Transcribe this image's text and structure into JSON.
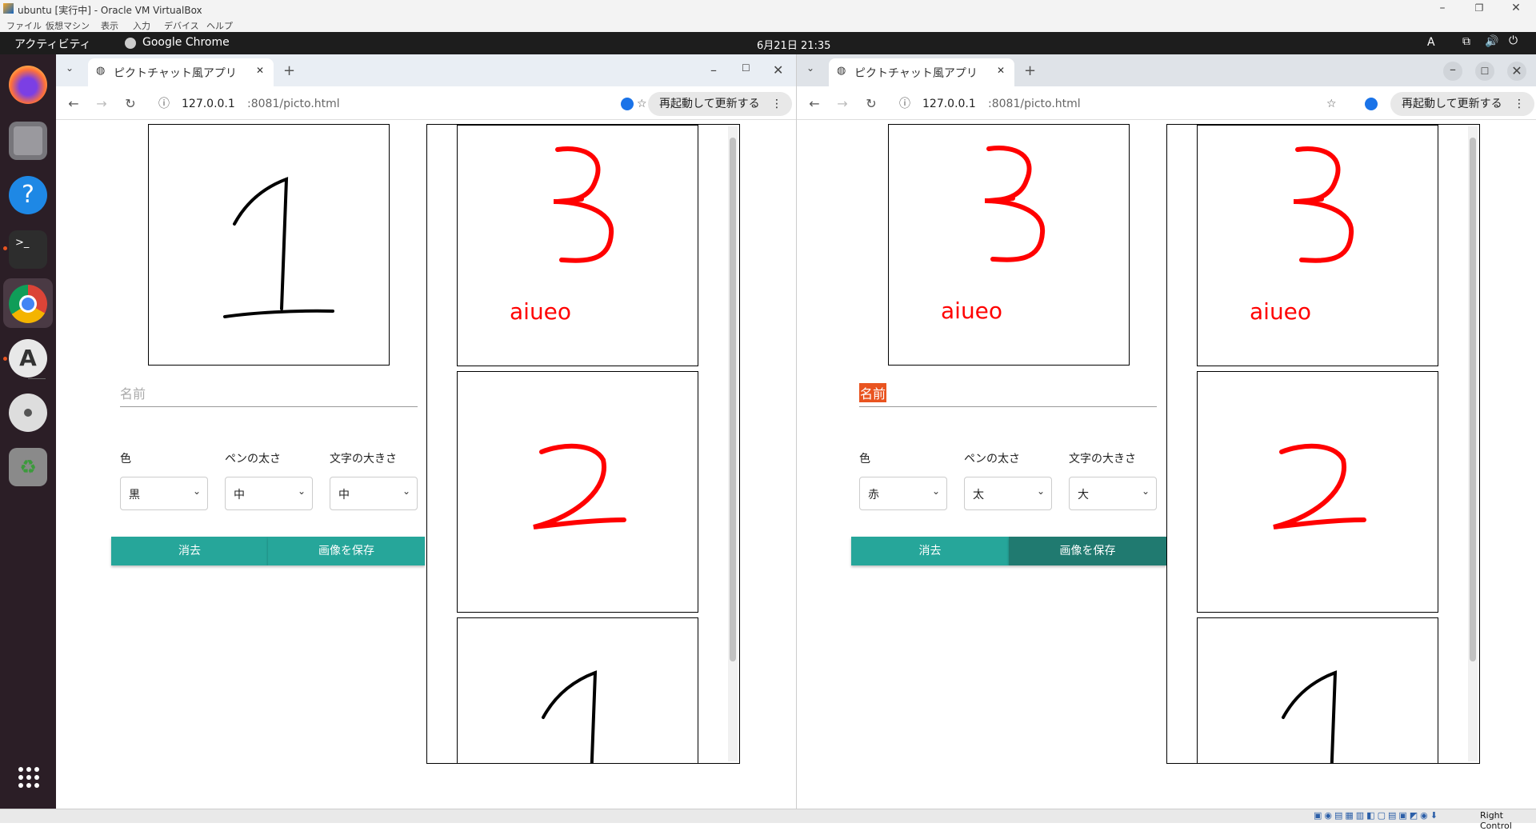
{
  "vbox": {
    "title": "ubuntu [実行中] - Oracle VM VirtualBox",
    "menu": [
      "ファイル",
      "仮想マシン",
      "表示",
      "入力",
      "デバイス",
      "ヘルプ"
    ],
    "host_key": "Right Control"
  },
  "topbar": {
    "activities": "アクティビティ",
    "app": "Google Chrome",
    "clock": "6月21日  21:35",
    "input": "A"
  },
  "dock": [
    "firefox-icon",
    "files-icon",
    "help-icon",
    "terminal-icon",
    "chrome-icon",
    "software-icon",
    "dvd-icon",
    "trash-icon",
    "app-grid-icon"
  ],
  "windows": [
    {
      "tab_title": "ピクトチャット風アプリ",
      "url_host": "127.0.0.1",
      "url_rest": ":8081/picto.html",
      "relaunch": "再起動して更新する",
      "name_value": "",
      "name_placeholder": "名前",
      "labels": {
        "color": "色",
        "pen": "ペンの太さ",
        "font": "文字の大きさ"
      },
      "selects": {
        "color": "黒",
        "pen": "中",
        "font": "中"
      },
      "buttons": {
        "clear": "消去",
        "save": "画像を保存"
      },
      "canvas_text": "",
      "feed": [
        {
          "figure": "3",
          "text": "aiueo",
          "color": "#ff0000"
        },
        {
          "figure": "2",
          "text": "",
          "color": "#ff0000"
        },
        {
          "figure": "1",
          "text": "",
          "color": "#000000"
        }
      ]
    },
    {
      "tab_title": "ピクトチャット風アプリ",
      "url_host": "127.0.0.1",
      "url_rest": ":8081/picto.html",
      "relaunch": "再起動して更新する",
      "name_value": "名前",
      "name_placeholder": "名前",
      "labels": {
        "color": "色",
        "pen": "ペンの太さ",
        "font": "文字の大きさ"
      },
      "selects": {
        "color": "赤",
        "pen": "太",
        "font": "大"
      },
      "buttons": {
        "clear": "消去",
        "save": "画像を保存"
      },
      "canvas_text": "aiueo",
      "feed": [
        {
          "figure": "3",
          "text": "aiueo",
          "color": "#ff0000"
        },
        {
          "figure": "2",
          "text": "",
          "color": "#ff0000"
        },
        {
          "figure": "1",
          "text": "",
          "color": "#000000"
        }
      ]
    }
  ],
  "colors": {
    "button": "#26a69a",
    "button_dark": "#207a70",
    "ink_red": "#ff0000",
    "ink_black": "#000000",
    "dock": "#2b1e26"
  }
}
